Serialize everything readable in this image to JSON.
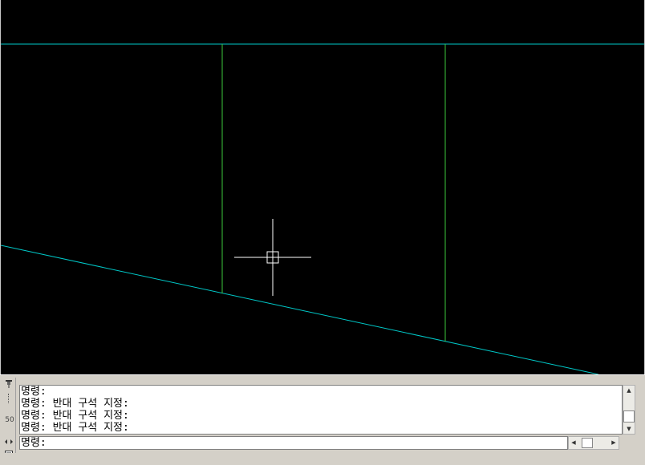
{
  "drawing": {
    "background_color": "#000000",
    "line_colors": {
      "cyan": "#00c8c8",
      "green": "#3cc83c",
      "crosshair": "#ffffff"
    }
  },
  "command_window": {
    "history": [
      "명령:",
      "명령: 반대 구석 지정:",
      "명령: 반대 구석 지정:",
      "명령: 반대 구석 지정:"
    ],
    "prompt": "명령:",
    "side_number": "50",
    "icons": {
      "pin": "pin-icon",
      "resize": "resize-icon",
      "properties": "properties-icon",
      "scroll_up": "scroll-up-arrow",
      "scroll_down": "scroll-down-arrow",
      "scroll_left": "scroll-left-arrow",
      "scroll_right": "scroll-right-arrow"
    }
  }
}
